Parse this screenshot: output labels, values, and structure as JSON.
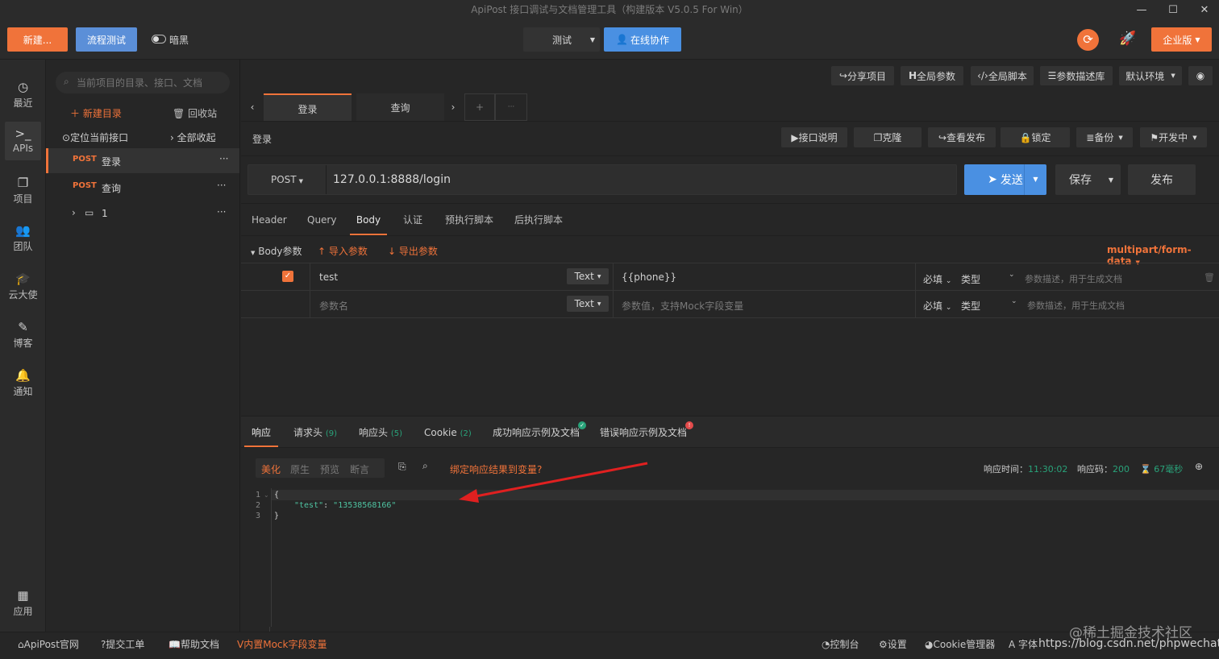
{
  "window": {
    "title": "ApiPost 接口调试与文档管理工具（构建版本 V5.0.5 For Win）",
    "min": "—",
    "max": "☐",
    "close": "✕"
  },
  "toolbar": {
    "new_label": "新建...",
    "flow_label": "流程测试",
    "dark_label": "暗黑",
    "env_select": "测试",
    "collab_label": "在线协作",
    "enterprise_label": "企业版"
  },
  "nav": [
    {
      "label": "最近",
      "icon": "clock-icon",
      "glyph": "◷"
    },
    {
      "label": "APIs",
      "icon": "terminal-icon",
      "glyph": ">_"
    },
    {
      "label": "项目",
      "icon": "project-icon",
      "glyph": "❐"
    },
    {
      "label": "团队",
      "icon": "team-icon",
      "glyph": "👥"
    },
    {
      "label": "云大使",
      "icon": "graduation-cap-icon",
      "glyph": "🎓"
    },
    {
      "label": "博客",
      "icon": "edit-icon",
      "glyph": "✎"
    },
    {
      "label": "通知",
      "icon": "bell-icon",
      "glyph": "🔔"
    },
    {
      "label": "应用",
      "icon": "apps-grid-icon",
      "glyph": "▦"
    }
  ],
  "tree": {
    "search_placeholder": "当前项目的目录、接口、文档",
    "new_dir": "新建目录",
    "recycle": "回收站",
    "locate": "定位当前接口",
    "collapse_all": "全部收起",
    "items": [
      {
        "method": "POST",
        "name": "登录"
      },
      {
        "method": "POST",
        "name": "查询"
      },
      {
        "method": "",
        "name": "1"
      }
    ]
  },
  "top_actions": [
    "分享项目",
    "全局参数",
    "全局脚本",
    "参数描述库",
    "默认环境"
  ],
  "tabs": [
    "登录",
    "查询"
  ],
  "tab_plus": "+",
  "tab_more": "···",
  "api": {
    "title": "登录",
    "actions": [
      "接口说明",
      "克隆",
      "查看发布",
      "锁定",
      "备份",
      "开发中"
    ],
    "method": "POST",
    "url": "127.0.0.1:8888/login",
    "send": "发送",
    "save": "保存",
    "publish": "发布"
  },
  "param_tabs": [
    "Header",
    "Query",
    "Body",
    "认证",
    "预执行脚本",
    "后执行脚本"
  ],
  "body": {
    "label": "Body参数",
    "import": "导入参数",
    "export": "导出参数",
    "content_type": "multipart/form-data",
    "rows": [
      {
        "checked": true,
        "name": "test",
        "type": "Text",
        "value": "{{phone}}",
        "required": "必填",
        "vtype": "类型",
        "desc": "参数描述，用于生成文档"
      },
      {
        "checked": false,
        "name": "参数名",
        "type": "Text",
        "value": "参数值，支持Mock字段变量",
        "required": "必填",
        "vtype": "类型",
        "desc": "参数描述，用于生成文档"
      }
    ]
  },
  "response": {
    "tabs": [
      {
        "label": "响应",
        "count": ""
      },
      {
        "label": "请求头",
        "count": "(9)"
      },
      {
        "label": "响应头",
        "count": "(5)"
      },
      {
        "label": "Cookie",
        "count": "(2)"
      },
      {
        "label": "成功响应示例及文档",
        "count": ""
      },
      {
        "label": "错误响应示例及文档",
        "count": ""
      }
    ],
    "modes": [
      "美化",
      "原生",
      "预览",
      "断言"
    ],
    "bind": "绑定响应结果到变量?",
    "time_label": "响应时间：",
    "time": "11:30:02",
    "code_label": "响应码：",
    "code": "200",
    "duration": "67毫秒",
    "lines": [
      "1",
      "2",
      "3"
    ],
    "body_line1": "{",
    "body_key": "\"test\"",
    "body_colon": ": ",
    "body_val": "\"13538568166\"",
    "body_line3": "}"
  },
  "statusbar": {
    "left": [
      "ApiPost官网",
      "提交工单",
      "帮助文档",
      "内置Mock字段变量"
    ],
    "right": [
      "控制台",
      "设置",
      "Cookie管理器",
      "字体"
    ],
    "watermark1": "@稀土掘金技术社区",
    "watermark2": "https://blog.csdn.net/phpwechat"
  },
  "colors": {
    "accent": "#f0733a",
    "primary": "#4a90e2",
    "success": "#29a37a",
    "danger": "#e34b4b"
  }
}
